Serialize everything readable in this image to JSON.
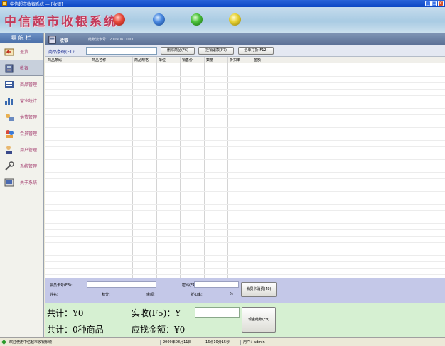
{
  "window": {
    "title": "中信超市收银系统 — [收银]",
    "controls": [
      "_",
      "□",
      "×"
    ]
  },
  "banner": {
    "app_title": "中信超市收银系统"
  },
  "sidebar": {
    "header": "导航栏",
    "items": [
      {
        "label": "退货",
        "icon": "return-icon"
      },
      {
        "label": "收银",
        "icon": "cash-register-icon"
      },
      {
        "label": "商品管理",
        "icon": "goods-management-icon"
      },
      {
        "label": "营业统计",
        "icon": "bar-chart-icon"
      },
      {
        "label": "供货管理",
        "icon": "supply-icon"
      },
      {
        "label": "会员管理",
        "icon": "members-icon"
      },
      {
        "label": "用户管理",
        "icon": "user-icon"
      },
      {
        "label": "系统管理",
        "icon": "system-tools-icon"
      },
      {
        "label": "关于系统",
        "icon": "about-icon"
      }
    ],
    "active_index": 1
  },
  "panel": {
    "title": "收银",
    "order_no": "结账流水号：20090811000"
  },
  "toolbar": {
    "barcode_label": "商品条码(F1):",
    "barcode_value": "",
    "btn_remove": "删除商品(F6)",
    "btn_hold": "挂销退款(F7)",
    "btn_print": "全单打折(F12)"
  },
  "grid": {
    "columns": [
      "商品条码",
      "商品名称",
      "商品规格",
      "单位",
      "销售价",
      "数量",
      "折扣率",
      "金额"
    ],
    "rows": []
  },
  "member": {
    "card_label": "会员卡号(F3):",
    "password_label": "密码(F4):",
    "name_label": "姓名:",
    "points_label": "积分:",
    "balance_label": "余额:",
    "discount_label": "折扣率:",
    "discount_unit": "%",
    "card_value": "",
    "password_value": "",
    "pay_button": "会员卡消费(F8)"
  },
  "totals": {
    "total": "共计：Y0",
    "received_label": "实收(F5)：Y",
    "received_value": "",
    "count": "共计：0种商品",
    "change": "应找金额：¥0",
    "cash_button": "现金结账(F9)"
  },
  "statusbar": {
    "welcome": "欢迎使用中信超市收银系统！",
    "date": "2009年08月11日",
    "time": "16点10分15秒",
    "user": "用户：admin"
  }
}
